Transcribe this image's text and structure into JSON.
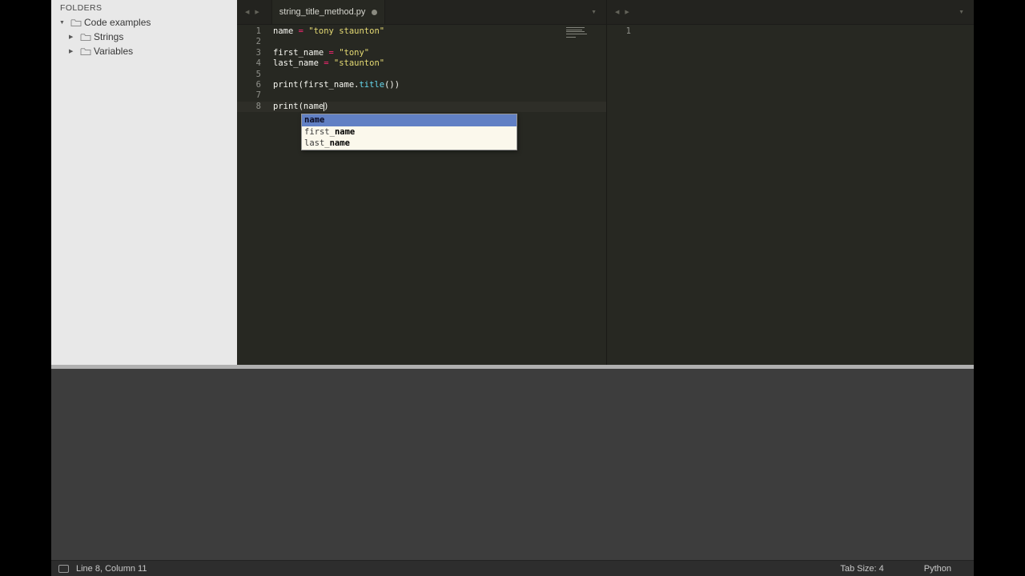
{
  "colors": {
    "editor_bg": "#272822",
    "sidebar_bg": "#e8e8e8",
    "plain": "#f8f8f2",
    "operator": "#f92672",
    "string": "#e6db74",
    "function": "#66d9ef",
    "gutter": "#8f908a",
    "popup_bg": "#fbf8ec",
    "popup_selected_bg": "#6180c4"
  },
  "sidebar": {
    "header": "FOLDERS",
    "tree": [
      {
        "label": "Code examples",
        "expanded": true,
        "level": 0
      },
      {
        "label": "Strings",
        "expanded": false,
        "level": 1
      },
      {
        "label": "Variables",
        "expanded": false,
        "level": 1
      }
    ]
  },
  "left_pane": {
    "tab_title": "string_title_method.py",
    "modified": true,
    "current_line": "8",
    "lines": [
      {
        "n": "1",
        "tokens": [
          [
            "name ",
            "plain"
          ],
          [
            "= ",
            "op"
          ],
          [
            "\"tony staunton\"",
            "str"
          ]
        ]
      },
      {
        "n": "2",
        "tokens": []
      },
      {
        "n": "3",
        "tokens": [
          [
            "first_name ",
            "plain"
          ],
          [
            "= ",
            "op"
          ],
          [
            "\"tony\"",
            "str"
          ]
        ]
      },
      {
        "n": "4",
        "tokens": [
          [
            "last_name ",
            "plain"
          ],
          [
            "= ",
            "op"
          ],
          [
            "\"staunton\"",
            "str"
          ]
        ]
      },
      {
        "n": "5",
        "tokens": []
      },
      {
        "n": "6",
        "tokens": [
          [
            "print(first_name.",
            "plain"
          ],
          [
            "title",
            "fn"
          ],
          [
            "())",
            "plain"
          ]
        ]
      },
      {
        "n": "7",
        "tokens": []
      },
      {
        "n": "8",
        "tokens": [
          [
            "print(name",
            "plain"
          ],
          [
            "",
            "cursor"
          ],
          [
            ")",
            "plain"
          ]
        ]
      }
    ]
  },
  "right_pane": {
    "lines": [
      {
        "n": "1",
        "tokens": []
      }
    ]
  },
  "autocomplete": {
    "selected_index": 0,
    "items": [
      {
        "pre": "",
        "match": "name"
      },
      {
        "pre": "first_",
        "match": "name"
      },
      {
        "pre": "last_",
        "match": "name"
      }
    ]
  },
  "status_bar": {
    "position": "Line 8, Column 11",
    "tab_size": "Tab Size: 4",
    "syntax": "Python"
  }
}
